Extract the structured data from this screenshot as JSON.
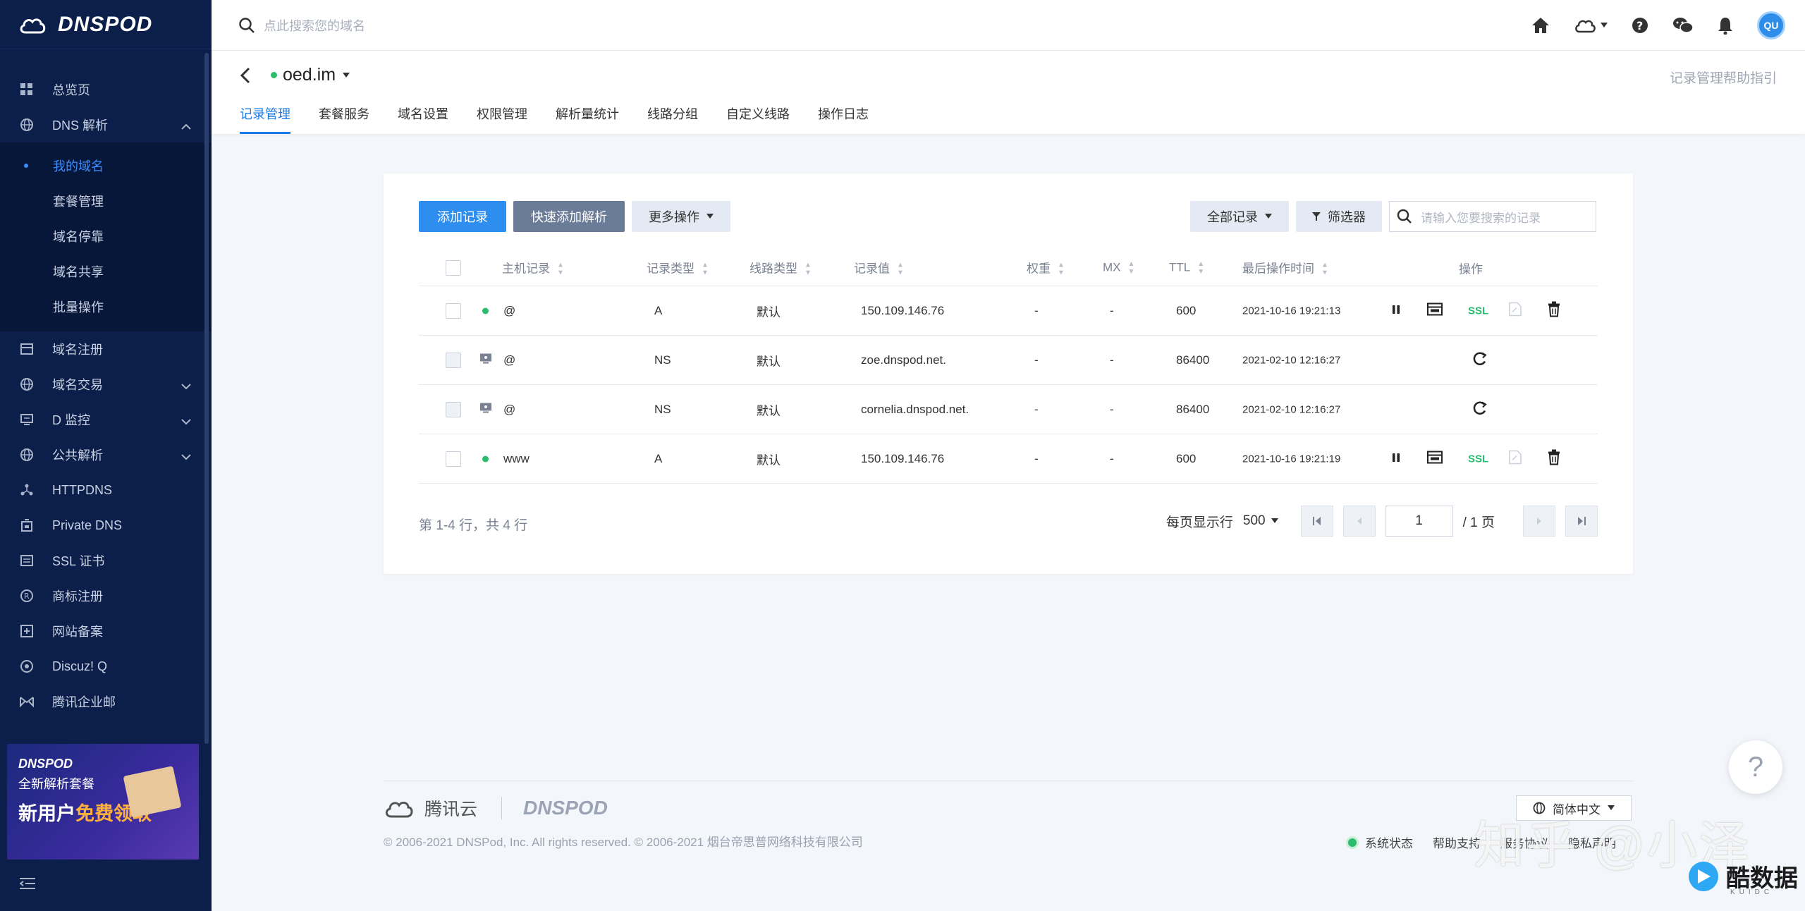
{
  "sidebar": {
    "brand": "DNSPOD",
    "items": [
      {
        "label": "总览页",
        "icon": "dashboard-icon"
      },
      {
        "label": "DNS 解析",
        "icon": "globe-icon"
      }
    ],
    "dns_sub": [
      {
        "label": "我的域名"
      },
      {
        "label": "套餐管理"
      },
      {
        "label": "域名停靠"
      },
      {
        "label": "域名共享"
      },
      {
        "label": "批量操作"
      }
    ],
    "items2": [
      {
        "label": "域名注册",
        "icon": "register-icon"
      },
      {
        "label": "域名交易",
        "icon": "globe-icon"
      },
      {
        "label": "D 监控",
        "icon": "monitor-icon"
      },
      {
        "label": "公共解析",
        "icon": "globe-icon"
      },
      {
        "label": "HTTPDNS",
        "icon": "network-icon"
      },
      {
        "label": "Private DNS",
        "icon": "building-icon"
      },
      {
        "label": "SSL 证书",
        "icon": "certificate-icon"
      },
      {
        "label": "商标注册",
        "icon": "trademark-icon"
      },
      {
        "label": "网站备案",
        "icon": "record-icon"
      },
      {
        "label": "Discuz! Q",
        "icon": "discuz-icon"
      },
      {
        "label": "腾讯企业邮",
        "icon": "mail-icon"
      }
    ],
    "banner": {
      "brand": "DNSPOD",
      "line1": "全新解析套餐",
      "line2_a": "新用户",
      "line2_b": "免费领取"
    }
  },
  "topbar": {
    "search_placeholder": "点此搜索您的域名",
    "avatar_text": "QU"
  },
  "header": {
    "domain": "oed.im",
    "help_link": "记录管理帮助指引",
    "tabs": [
      "记录管理",
      "套餐服务",
      "域名设置",
      "权限管理",
      "解析量统计",
      "线路分组",
      "自定义线路",
      "操作日志"
    ]
  },
  "toolbar": {
    "add_record": "添加记录",
    "quick_add": "快速添加解析",
    "more_ops": "更多操作",
    "all_records": "全部记录",
    "filter": "筛选器",
    "search_placeholder": "请输入您要搜索的记录"
  },
  "table": {
    "headers": {
      "host": "主机记录",
      "type": "记录类型",
      "line": "线路类型",
      "value": "记录值",
      "weight": "权重",
      "mx": "MX",
      "ttl": "TTL",
      "time": "最后操作时间",
      "ops": "操作"
    },
    "rows": [
      {
        "host": "@",
        "type": "A",
        "line": "默认",
        "value": "150.109.146.76",
        "weight": "-",
        "mx": "-",
        "ttl": "600",
        "time": "2021-10-16 19:21:13",
        "kind": "normal",
        "ssl": "SSL"
      },
      {
        "host": "@",
        "type": "NS",
        "line": "默认",
        "value": "zoe.dnspod.net.",
        "weight": "-",
        "mx": "-",
        "ttl": "86400",
        "time": "2021-02-10 12:16:27",
        "kind": "system"
      },
      {
        "host": "@",
        "type": "NS",
        "line": "默认",
        "value": "cornelia.dnspod.net.",
        "weight": "-",
        "mx": "-",
        "ttl": "86400",
        "time": "2021-02-10 12:16:27",
        "kind": "system"
      },
      {
        "host": "www",
        "type": "A",
        "line": "默认",
        "value": "150.109.146.76",
        "weight": "-",
        "mx": "-",
        "ttl": "600",
        "time": "2021-10-16 19:21:19",
        "kind": "normal",
        "ssl": "SSL"
      }
    ]
  },
  "pagination": {
    "info": "第 1-4 行，共 4 行",
    "per_page_label": "每页显示行",
    "per_page": "500",
    "page": "1",
    "total": "/ 1 页"
  },
  "footer": {
    "tencent": "腾讯云",
    "dnspod": "DNSPOD",
    "copyright": "© 2006-2021 DNSPod, Inc. All rights reserved. © 2006-2021 烟台帝思普网络科技有限公司",
    "language": "简体中文",
    "links": [
      "系统状态",
      "帮助支持",
      "服务协议",
      "隐私声明"
    ]
  },
  "watermark": {
    "zhihu": "知乎 @小泽",
    "site": "酷数据",
    "site_sub": "KUIDC"
  },
  "colors": {
    "sidebar": "#0b1f4a",
    "accent": "#2d8ef0",
    "green": "#2bbd6d"
  }
}
